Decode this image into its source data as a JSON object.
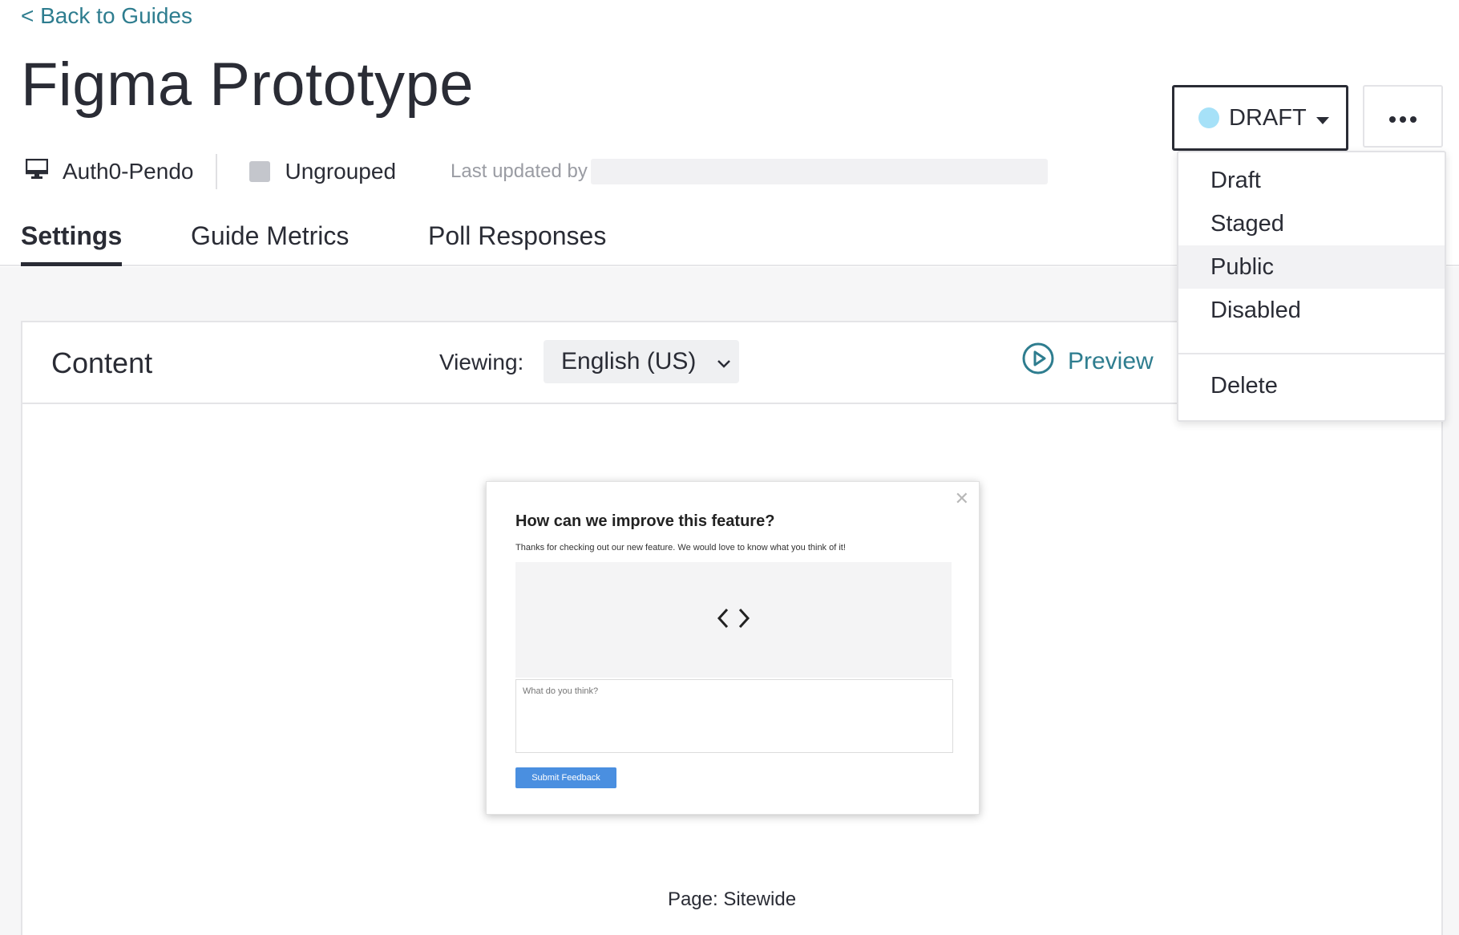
{
  "nav": {
    "back_label": "< Back to Guides"
  },
  "guide": {
    "title": "Figma Prototype",
    "app_name": "Auth0-Pendo",
    "group_name": "Ungrouped",
    "last_updated_label": "Last updated by"
  },
  "tabs": [
    {
      "label": "Settings",
      "active": true
    },
    {
      "label": "Guide Metrics",
      "active": false
    },
    {
      "label": "Poll Responses",
      "active": false
    }
  ],
  "status": {
    "current": "DRAFT",
    "dot_color": "#a6e1f8",
    "menu": [
      {
        "label": "Draft"
      },
      {
        "label": "Staged"
      },
      {
        "label": "Public",
        "highlighted": true
      },
      {
        "label": "Disabled"
      },
      {
        "label": "Delete"
      }
    ]
  },
  "content": {
    "title": "Content",
    "viewing_label": "Viewing:",
    "language": "English (US)",
    "preview_label": "Preview",
    "page_scope": "Page: Sitewide"
  },
  "guide_preview": {
    "title": "How can we improve this feature?",
    "subtitle": "Thanks for checking out our new feature. We would love to know what you think of it!",
    "textarea_placeholder": "What do you think?",
    "submit_label": "Submit Feedback",
    "submit_color": "#4a8fe0"
  },
  "colors": {
    "link": "#2e7d8f",
    "text": "#2a2c35"
  }
}
